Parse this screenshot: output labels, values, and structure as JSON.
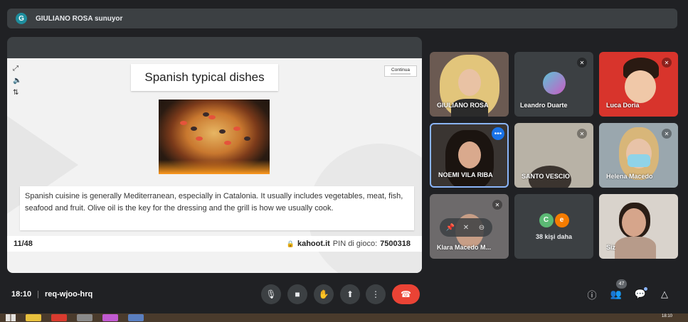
{
  "presenter": {
    "avatar_letter": "G",
    "text": "GIULIANO ROSA sunuyor"
  },
  "slide": {
    "controls": [
      "⤢",
      "🔈",
      "⇅"
    ],
    "title": "Spanish typical dishes",
    "continue_label": "Continua",
    "body": "Spanish cuisine is generally Mediterranean, especially in Catalonia. It usually includes vegetables, meat, fish, seafood and fruit. Olive oil is the key for the dressing and the grill is how we usually cook.",
    "counter": "11/48",
    "site": "kahoot.it",
    "pin_label": "PIN di gioco:",
    "pin": "7500318"
  },
  "participants": [
    {
      "name": "GIULIANO ROSA",
      "muted": false
    },
    {
      "name": "Leandro Duarte",
      "muted": true
    },
    {
      "name": "Luca Doria",
      "muted": true
    },
    {
      "name": "NOEMI VILA RIBA",
      "muted": false,
      "active": true
    },
    {
      "name": "SANTO VESCIO",
      "muted": true
    },
    {
      "name": "Helena Macedo",
      "muted": true
    },
    {
      "name": "Klara Macedo M...",
      "muted": true
    },
    {
      "name": "Siz",
      "muted": false
    }
  ],
  "more_people": {
    "avatars": [
      "C",
      "e"
    ],
    "label": "38 kişi daha"
  },
  "bottom": {
    "time": "18:10",
    "meeting_code": "req-wjoo-hrq",
    "participant_count": "47"
  },
  "taskbar": {
    "clock": "18:10"
  },
  "colors": {
    "hangup": "#ea4335",
    "active_border": "#8ab4f8",
    "presenter_avatar": "#1e8e9e"
  }
}
